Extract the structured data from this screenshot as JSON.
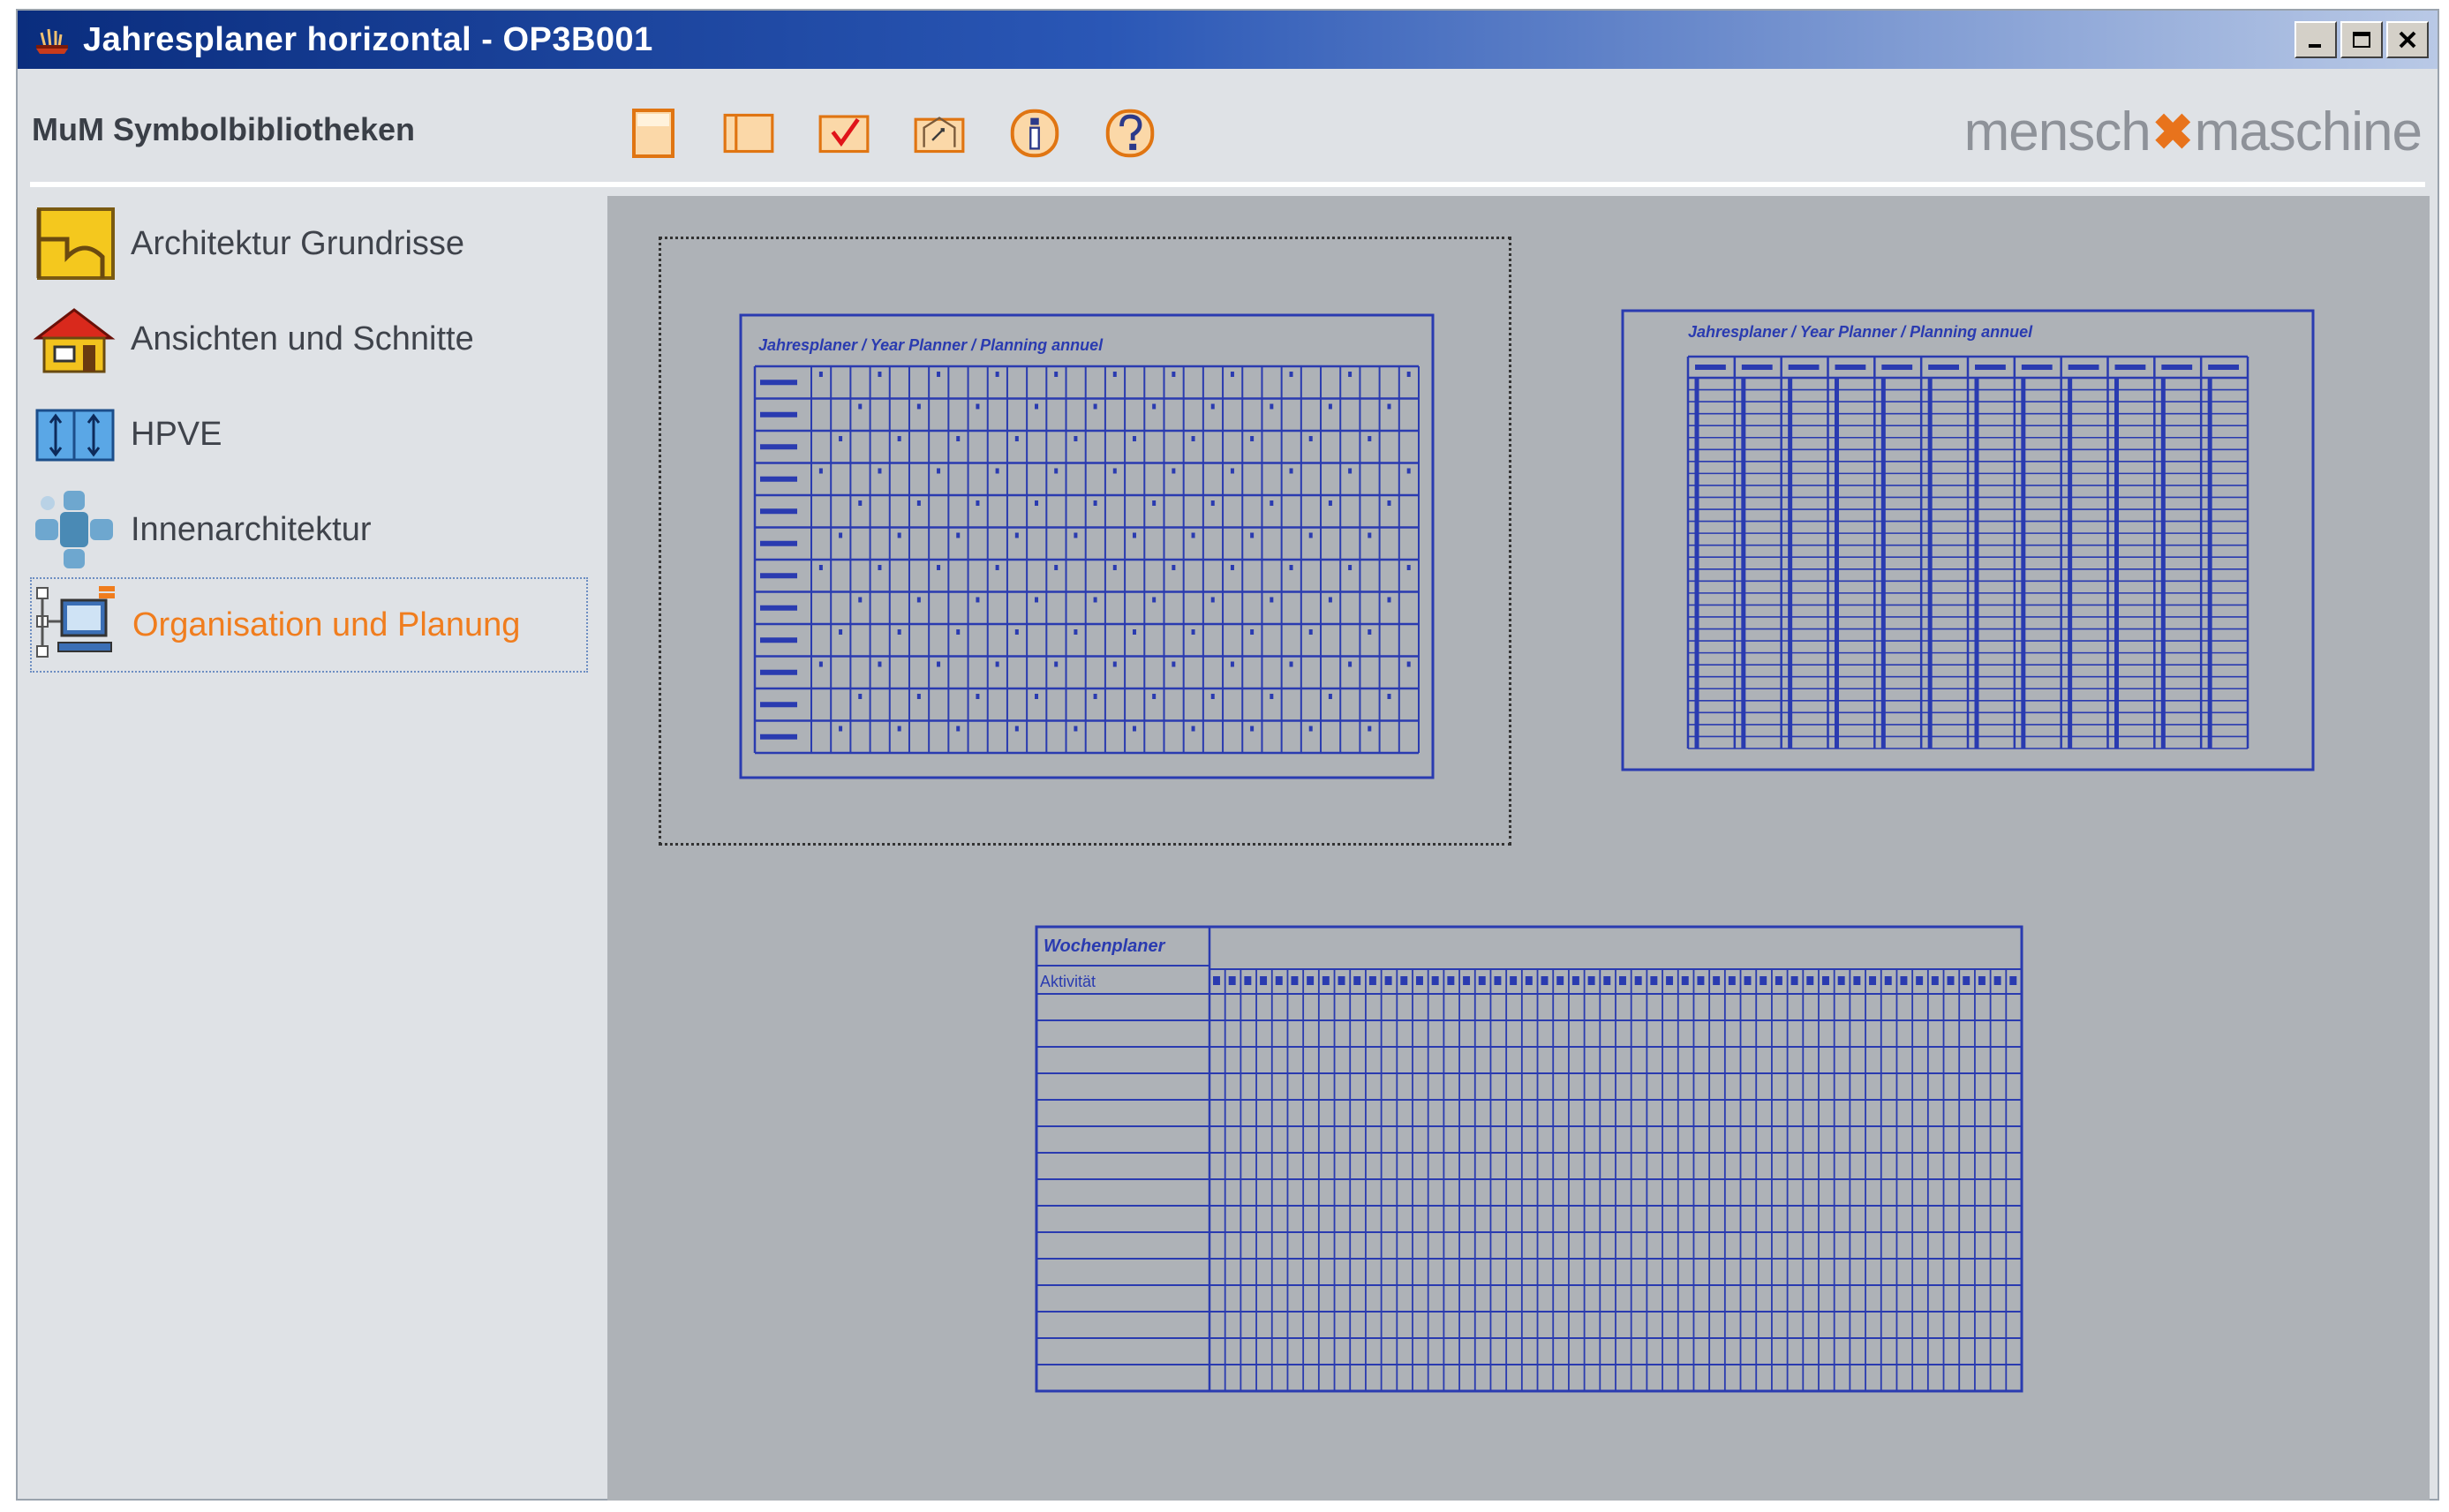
{
  "window": {
    "title": "Jahresplaner horizontal - OP3B001",
    "controls": [
      "minimize",
      "maximize",
      "close"
    ]
  },
  "header": {
    "title": "MuM Symbolbibliotheken",
    "toolbar": [
      {
        "icon": "single-page-icon"
      },
      {
        "icon": "double-page-icon"
      },
      {
        "icon": "checkmark-icon"
      },
      {
        "icon": "insert-symbol-icon"
      },
      {
        "icon": "info-icon"
      },
      {
        "icon": "help-icon"
      }
    ],
    "logo": {
      "left": "mensch",
      "mark": "✖",
      "right": "maschine"
    }
  },
  "sidebar": {
    "items": [
      {
        "label": "Architektur Grundrisse",
        "icon": "floorplan-icon",
        "active": false
      },
      {
        "label": "Ansichten und Schnitte",
        "icon": "house-icon",
        "active": false
      },
      {
        "label": "HPVE",
        "icon": "hpve-icon",
        "active": false
      },
      {
        "label": "Innenarchitektur",
        "icon": "furniture-icon",
        "active": false
      },
      {
        "label": "Organisation und Planung",
        "icon": "network-computer-icon",
        "active": true
      }
    ]
  },
  "preview": {
    "thumbnails": [
      {
        "title": "Jahresplaner / Year Planner / Planning annuel",
        "selected": true
      },
      {
        "title": "Jahresplaner / Year Planner / Planning annuel",
        "selected": false
      },
      {
        "title": "Wochenplaner",
        "subtitle": "Aktivität",
        "selected": false
      }
    ]
  },
  "colors": {
    "titlebar_start": "#0a2d7e",
    "accent": "#f07d1e",
    "drawing_blue": "#2a3bb0",
    "preview_bg": "#aeb2b7"
  }
}
